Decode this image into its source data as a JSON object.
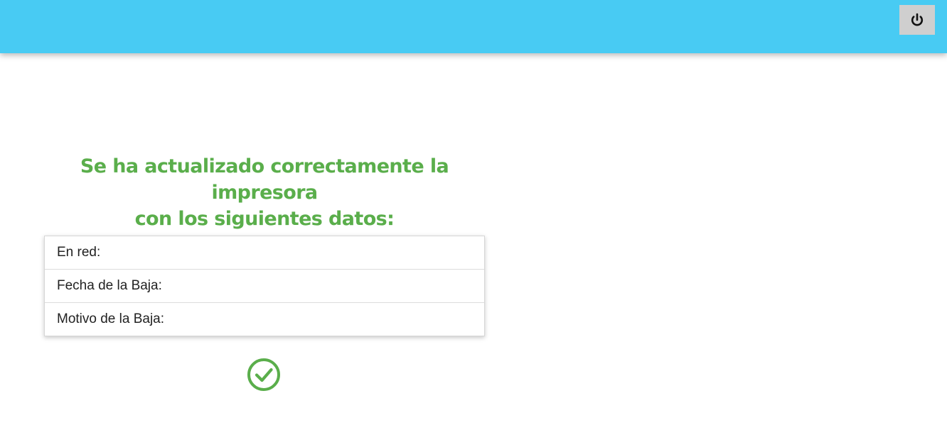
{
  "header": {
    "background_color": "#48cbf3",
    "logout_button": {
      "icon": "power-icon"
    }
  },
  "main": {
    "title_line1": "Se ha actualizado correctamente la impresora",
    "title_line2": "con los siguientes datos:",
    "title_color": "#5aae4b",
    "rows": [
      {
        "label": "En red:"
      },
      {
        "label": "Fecha de la Baja:"
      },
      {
        "label": "Motivo de la Baja:"
      }
    ],
    "status_icon": "check-circle-icon",
    "status_color": "#5aae4b"
  }
}
